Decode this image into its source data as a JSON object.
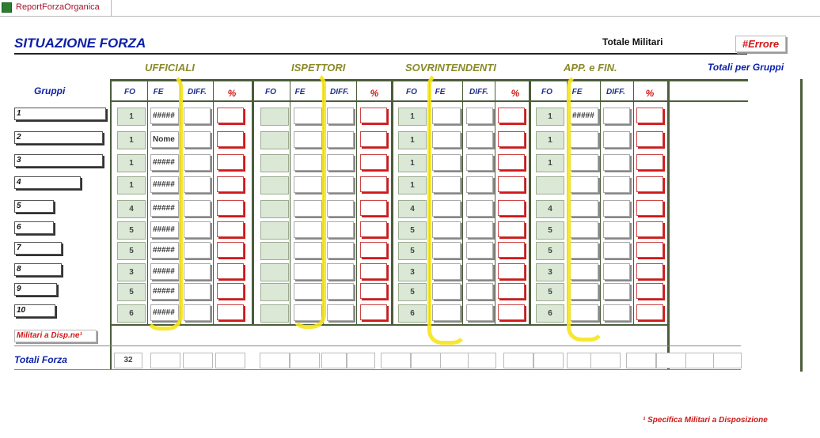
{
  "tab": {
    "title": "ReportForzaOrganica"
  },
  "header": {
    "title": "SITUAZIONE FORZA",
    "totale_militari_label": "Totale Militari",
    "totale_militari_value": "#Errore",
    "totali_gruppi_label": "Totali per Gruppi"
  },
  "sections": [
    "UFFICIALI",
    "ISPETTORI",
    "SOVRINTENDENTI",
    "APP. e FIN."
  ],
  "columns": {
    "fo": "FO",
    "fe": "FE",
    "diff": "DIFF.",
    "pct": "%"
  },
  "gruppi_label": "Gruppi",
  "rows": [
    {
      "label": "1",
      "uff_fo": "1",
      "uff_fe": "#####",
      "isp_fo": "",
      "sov_fo": "1",
      "app_fo": "1",
      "app_fe": "#####"
    },
    {
      "label": "2",
      "uff_fo": "1",
      "uff_fe": "Nome",
      "isp_fo": "",
      "sov_fo": "1",
      "app_fo": "1",
      "app_fe": ""
    },
    {
      "label": "3",
      "uff_fo": "1",
      "uff_fe": "#####",
      "isp_fo": "",
      "sov_fo": "1",
      "app_fo": "1",
      "app_fe": ""
    },
    {
      "label": "4",
      "uff_fo": "1",
      "uff_fe": "#####",
      "isp_fo": "",
      "sov_fo": "1",
      "app_fo": "",
      "app_fe": ""
    },
    {
      "label": "5",
      "uff_fo": "4",
      "uff_fe": "#####",
      "isp_fo": "",
      "sov_fo": "4",
      "app_fo": "4",
      "app_fe": ""
    },
    {
      "label": "6",
      "uff_fo": "5",
      "uff_fe": "#####",
      "isp_fo": "",
      "sov_fo": "5",
      "app_fo": "5",
      "app_fe": ""
    },
    {
      "label": "7",
      "uff_fo": "5",
      "uff_fe": "#####",
      "isp_fo": "",
      "sov_fo": "5",
      "app_fo": "5",
      "app_fe": ""
    },
    {
      "label": "8",
      "uff_fo": "3",
      "uff_fe": "#####",
      "isp_fo": "",
      "sov_fo": "3",
      "app_fo": "3",
      "app_fe": ""
    },
    {
      "label": "9",
      "uff_fo": "5",
      "uff_fe": "#####",
      "isp_fo": "",
      "sov_fo": "5",
      "app_fo": "5",
      "app_fe": ""
    },
    {
      "label": "10",
      "uff_fo": "6",
      "uff_fe": "#####",
      "isp_fo": "",
      "sov_fo": "6",
      "app_fo": "6",
      "app_fe": ""
    }
  ],
  "militari_disp_label": "Militari a Disp.ne¹",
  "totali_forza_label": "Totali Forza",
  "totali_forza_value": "32",
  "footnote": "¹ Specifica Militari a Disposizione",
  "colors": {
    "accent_blue": "#0b1fa8",
    "error_red": "#d01818",
    "section_olive": "#8a8a2a",
    "highlight_yellow": "#f7e51a"
  }
}
